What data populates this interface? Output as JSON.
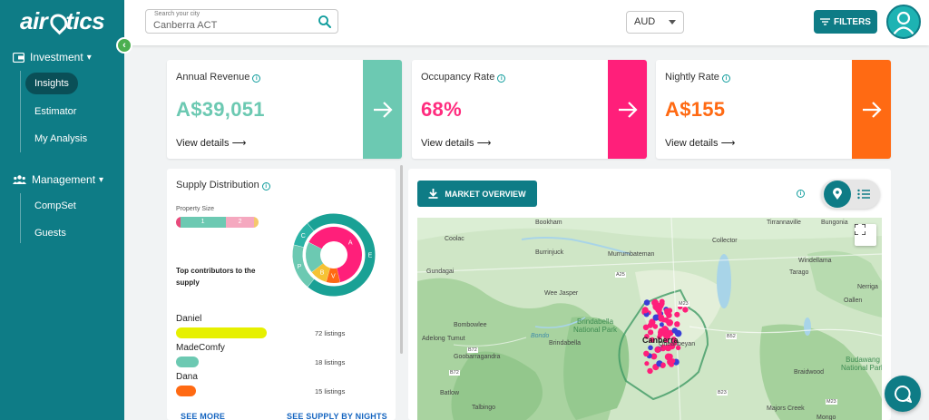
{
  "logo": {
    "lead": "air",
    "tail": "tics"
  },
  "sidebar": {
    "investment_label": "Investment",
    "investment_items": [
      {
        "label": "Insights",
        "active": true
      },
      {
        "label": "Estimator",
        "active": false
      },
      {
        "label": "My Analysis",
        "active": false
      }
    ],
    "management_label": "Management",
    "management_items": [
      {
        "label": "CompSet",
        "active": false
      },
      {
        "label": "Guests",
        "active": false
      }
    ]
  },
  "header": {
    "search_label": "Search your city",
    "search_value": "Canberra ACT",
    "currency": "AUD",
    "filters_label": "FILTERS"
  },
  "kpis": [
    {
      "title": "Annual Revenue",
      "value": "A$39,051",
      "link": "View details",
      "color": "#6cc9b2",
      "accent": "#6cc9b2"
    },
    {
      "title": "Occupancy Rate",
      "value": "68%",
      "link": "View details",
      "color": "#ff2d7f",
      "accent": "#ff1f7a"
    },
    {
      "title": "Nightly Rate",
      "value": "A$155",
      "link": "View details",
      "color": "#ff6a13",
      "accent": "#ff6a13"
    }
  ],
  "supply": {
    "title": "Supply Distribution",
    "property_size_label": "Property Size",
    "property_segments": [
      {
        "label": "",
        "share": 0.05,
        "color": "#e84a7b"
      },
      {
        "label": "1",
        "share": 0.55,
        "color": "#6cc9b2"
      },
      {
        "label": "2",
        "share": 0.35,
        "color": "#f5a8bf"
      },
      {
        "label": "",
        "share": 0.05,
        "color": "#f5c76b"
      }
    ],
    "donut_inner": [
      {
        "label": "A",
        "share": 0.64,
        "color": "#ff1f7a"
      },
      {
        "label": "V",
        "share": 0.08,
        "color": "#ff6a13"
      },
      {
        "label": "B",
        "share": 0.1,
        "color": "#f5c234"
      },
      {
        "label": "",
        "share": 0.18,
        "color": "#6cc9b2"
      }
    ],
    "donut_outer": [
      {
        "label": "E",
        "share": 0.72,
        "color": "#1aa195"
      },
      {
        "label": "P",
        "share": 0.18,
        "color": "#6cc9b2"
      },
      {
        "label": "C",
        "share": 0.1,
        "color": "#2bb3a6"
      }
    ],
    "top_contributors_label": "Top contributors to the supply",
    "contributors": [
      {
        "name": "Daniel",
        "listings": "72 listings",
        "share": 1.0,
        "color": "#e6f000"
      },
      {
        "name": "MadeComfy",
        "listings": "18 listings",
        "share": 0.25,
        "color": "#6cc9b2"
      },
      {
        "name": "Dana",
        "listings": "15 listings",
        "share": 0.21,
        "color": "#ff6a13"
      }
    ],
    "see_more": "SEE MORE",
    "see_by_nights": "SEE SUPPLY BY NIGHTS"
  },
  "map": {
    "market_overview": "MARKET OVERVIEW",
    "labels": [
      {
        "text": "Bookham",
        "cls": ""
      },
      {
        "text": "Tirrannaville",
        "cls": ""
      },
      {
        "text": "Bungonia",
        "cls": ""
      },
      {
        "text": "Coolac",
        "cls": ""
      },
      {
        "text": "Murrumbateman",
        "cls": ""
      },
      {
        "text": "Collector",
        "cls": ""
      },
      {
        "text": "Burrinjuck",
        "cls": ""
      },
      {
        "text": "Windellama",
        "cls": ""
      },
      {
        "text": "Gundagai",
        "cls": ""
      },
      {
        "text": "Tarago",
        "cls": ""
      },
      {
        "text": "Nerriga",
        "cls": ""
      },
      {
        "text": "Wee Jasper",
        "cls": ""
      },
      {
        "text": "Oallen",
        "cls": ""
      },
      {
        "text": "Bombowlee",
        "cls": ""
      },
      {
        "text": "Brindabella National Park",
        "cls": "green"
      },
      {
        "text": "Bondo",
        "cls": "river"
      },
      {
        "text": "Adelong",
        "cls": ""
      },
      {
        "text": "Tumut",
        "cls": ""
      },
      {
        "text": "Brindabella",
        "cls": ""
      },
      {
        "text": "Canberra",
        "cls": "city"
      },
      {
        "text": "Queanbeyan",
        "cls": ""
      },
      {
        "text": "Goobarragandra",
        "cls": ""
      },
      {
        "text": "Budawang National Park",
        "cls": "green"
      },
      {
        "text": "Braidwood",
        "cls": ""
      },
      {
        "text": "Batlow",
        "cls": ""
      },
      {
        "text": "Talbingo",
        "cls": ""
      },
      {
        "text": "Majors Creek",
        "cls": ""
      },
      {
        "text": "Mongo",
        "cls": ""
      }
    ],
    "road_labels": [
      "A25",
      "M23",
      "B72",
      "B72",
      "B52",
      "B23",
      "M23"
    ]
  },
  "icons": [
    "collapse-chevron-icon",
    "wallet-icon",
    "chevron-down-icon",
    "people-icon",
    "search-icon",
    "caret-down-icon",
    "filter-lines-icon",
    "user-avatar-icon",
    "info-icon",
    "arrow-right-icon",
    "download-icon",
    "map-pin-icon",
    "list-icon",
    "fullscreen-icon",
    "chat-icon"
  ]
}
